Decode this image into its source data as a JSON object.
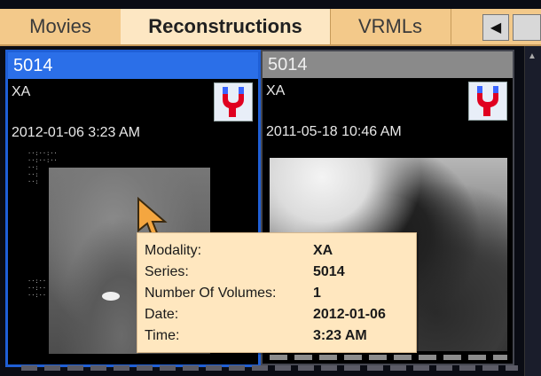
{
  "tabs": [
    {
      "label": "Movies"
    },
    {
      "label": "Reconstructions"
    },
    {
      "label": "VRMLs"
    }
  ],
  "tab_scroll": {
    "left_arrow": "◀"
  },
  "cards": [
    {
      "header": "5014",
      "modality": "XA",
      "datetime": "2012-01-06 3:23 AM",
      "icon": "vessel-icon",
      "dots": "··:··:··\n··:··:··\n··:\n··:\n··:\n\n\n\n\n\n\n\n\n\n\n\n\n\n··:··\n··:··\n··:··"
    },
    {
      "header": "5014",
      "modality": "XA",
      "datetime": "2011-05-18 10:46 AM",
      "icon": "vessel-icon"
    }
  ],
  "tooltip": {
    "rows": [
      {
        "key": "Modality:",
        "value": "XA"
      },
      {
        "key": "Series:",
        "value": "5014"
      },
      {
        "key": "Number Of Volumes:",
        "value": "1"
      },
      {
        "key": "Date:",
        "value": "2012-01-06"
      },
      {
        "key": "Time:",
        "value": "3:23 AM"
      }
    ]
  },
  "colors": {
    "tab_bg": "#f3c98a",
    "tab_active_bg": "#fde7c3",
    "selected_header": "#2b6fe8",
    "tooltip_bg": "#ffe7bf"
  }
}
